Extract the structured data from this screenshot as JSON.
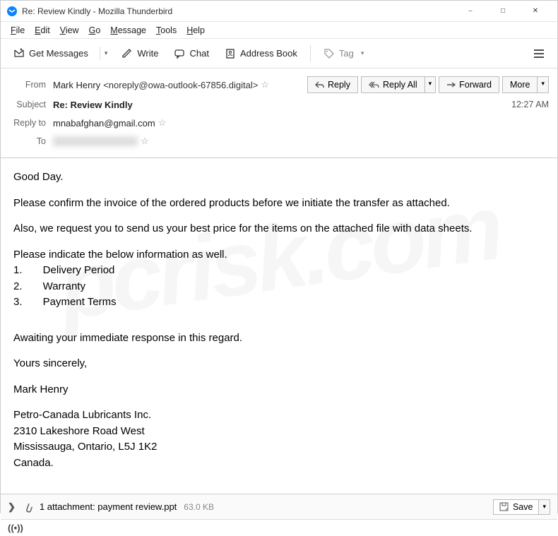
{
  "window": {
    "title": "Re: Review Kindly - Mozilla Thunderbird"
  },
  "menu": {
    "file": "File",
    "edit": "Edit",
    "view": "View",
    "go": "Go",
    "message": "Message",
    "tools": "Tools",
    "help": "Help"
  },
  "toolbar": {
    "get_messages": "Get Messages",
    "write": "Write",
    "chat": "Chat",
    "address_book": "Address Book",
    "tag": "Tag"
  },
  "headers": {
    "from_label": "From",
    "from_name": "Mark Henry",
    "from_addr": "<noreply@owa-outlook-67856.digital>",
    "subject_label": "Subject",
    "subject": "Re: Review Kindly",
    "reply_to_label": "Reply to",
    "reply_to": "mnabafghan@gmail.com",
    "to_label": "To",
    "time": "12:27 AM"
  },
  "actions": {
    "reply": "Reply",
    "reply_all": "Reply All",
    "forward": "Forward",
    "more": "More"
  },
  "body": {
    "l1": "Good Day.",
    "l2": "Please confirm the invoice of the ordered products before we initiate the transfer as attached.",
    "l3": "Also, we request you to send us your best price for the items on the attached file with data sheets.",
    "l4": "Please indicate the below information as well.",
    "li1": "1.       Delivery Period",
    "li2": "2.       Warranty",
    "li3": "3.       Payment Terms",
    "l5": "Awaiting your immediate response in this regard.",
    "l6": "Yours sincerely,",
    "l7": "Mark Henry",
    "l8": "Petro-Canada Lubricants Inc.",
    "l9": "2310 Lakeshore Road West",
    "l10": "Mississauga, Ontario, L5J 1K2",
    "l11": "Canada."
  },
  "attachment": {
    "expand": ">",
    "text": "1 attachment: payment review.ppt",
    "size": "63.0 KB",
    "save": "Save"
  }
}
